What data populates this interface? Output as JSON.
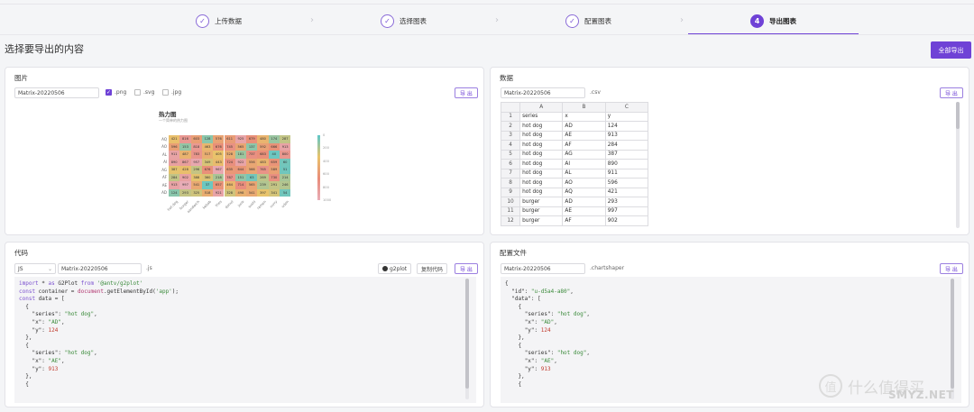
{
  "steps": [
    {
      "label": "上传数据",
      "mark": "✓"
    },
    {
      "label": "选择图表",
      "mark": "✓"
    },
    {
      "label": "配置图表",
      "mark": "✓"
    },
    {
      "label": "导出图表",
      "mark": "4"
    }
  ],
  "page_title": "选择要导出的内容",
  "export_all": "全部导出",
  "image_panel": {
    "title": "图片",
    "filename": "Matrix-20220506",
    "formats": [
      {
        "label": ".png",
        "checked": true
      },
      {
        "label": ".svg",
        "checked": false
      },
      {
        "label": ".jpg",
        "checked": false
      }
    ],
    "export_label": "导 出"
  },
  "chart_data": {
    "type": "heatmap",
    "title": "热力图",
    "subtitle": "一个简单的热力图",
    "x": [
      "hot dog",
      "burger",
      "sandwich",
      "kebab",
      "fries",
      "donut",
      "junk",
      "sushi",
      "ramen",
      "curry",
      "udon"
    ],
    "y": [
      "AQ",
      "AO",
      "AL",
      "AI",
      "AG",
      "AF",
      "AE",
      "AD"
    ],
    "values": [
      [
        421,
        816,
        603,
        128,
        576,
        611,
        925,
        679,
        480,
        174,
        287
      ],
      [
        596,
        153,
        818,
        463,
        676,
        745,
        565,
        137,
        592,
        666,
        913
      ],
      [
        911,
        487,
        783,
        517,
        405,
        528,
        181,
        737,
        683,
        40,
        800
      ],
      [
        890,
        867,
        957,
        349,
        443,
        724,
        922,
        556,
        483,
        659,
        60
      ],
      [
        387,
        428,
        296,
        676,
        967,
        635,
        644,
        566,
        765,
        589,
        51
      ],
      [
        284,
        902,
        388,
        360,
        218,
        787,
        151,
        63,
        269,
        730,
        214
      ],
      [
        913,
        997,
        541,
        37,
        657,
        464,
        714,
        565,
        239,
        291,
        246
      ],
      [
        124,
        293,
        325,
        518,
        921,
        328,
        498,
        541,
        397,
        341,
        54
      ]
    ],
    "legend_ticks": [
      "0",
      "200",
      "400",
      "600",
      "800",
      "1000"
    ]
  },
  "data_panel": {
    "title": "数据",
    "filename": "Matrix-20220506",
    "ext": ".csv",
    "export_label": "导 出",
    "columns": [
      "A",
      "B",
      "C"
    ],
    "rows": [
      {
        "n": "1",
        "a": "series",
        "b": "x",
        "c": "y"
      },
      {
        "n": "2",
        "a": "hot dog",
        "b": "AD",
        "c": "124"
      },
      {
        "n": "3",
        "a": "hot dog",
        "b": "AE",
        "c": "913"
      },
      {
        "n": "4",
        "a": "hot dog",
        "b": "AF",
        "c": "284"
      },
      {
        "n": "5",
        "a": "hot dog",
        "b": "AG",
        "c": "387"
      },
      {
        "n": "6",
        "a": "hot dog",
        "b": "AI",
        "c": "890"
      },
      {
        "n": "7",
        "a": "hot dog",
        "b": "AL",
        "c": "911"
      },
      {
        "n": "8",
        "a": "hot dog",
        "b": "AO",
        "c": "596"
      },
      {
        "n": "9",
        "a": "hot dog",
        "b": "AQ",
        "c": "421"
      },
      {
        "n": "10",
        "a": "burger",
        "b": "AD",
        "c": "293"
      },
      {
        "n": "11",
        "a": "burger",
        "b": "AE",
        "c": "997"
      },
      {
        "n": "12",
        "a": "burger",
        "b": "AF",
        "c": "902"
      }
    ]
  },
  "code_panel": {
    "title": "代码",
    "lang": "JS",
    "filename": "Matrix-20220506",
    "ext": ".js",
    "g2plot_label": "g2plot",
    "copy_label": "复制代码",
    "export_label": "导 出",
    "lines": {
      "l1a": "import",
      "l1b": " * ",
      "l1c": "as",
      "l1d": " G2Plot ",
      "l1e": "from",
      "l1f": " '@antv/g2plot'",
      "l2a": "const",
      "l2b": " container = ",
      "l2c": "document",
      "l2d": ".getElementById(",
      "l2e": "'app'",
      "l2f": ");",
      "l3a": "const",
      "l3b": " data = [",
      "l4": "  {",
      "k_series": "\"series\"",
      "k_x": "\"x\"",
      "k_y": "\"y\"",
      "v_hotdog": "\"hot dog\"",
      "v_ad": "\"AD\"",
      "v_ae": "\"AE\"",
      "v_124": "124",
      "v_913": "913",
      "close": "  },",
      "open": "  {"
    }
  },
  "config_panel": {
    "title": "配置文件",
    "filename": "Matrix-20220506",
    "ext": ".chartshaper",
    "export_label": "导 出",
    "k_id": "\"id\"",
    "v_id": "\"u-d5a4-a80\"",
    "k_data": "\"data\""
  },
  "watermark": {
    "text": "什么值得买",
    "mark": "值",
    "domain": "SMYZ.NET"
  },
  "colors": {
    "accent": "#6f42d6"
  }
}
